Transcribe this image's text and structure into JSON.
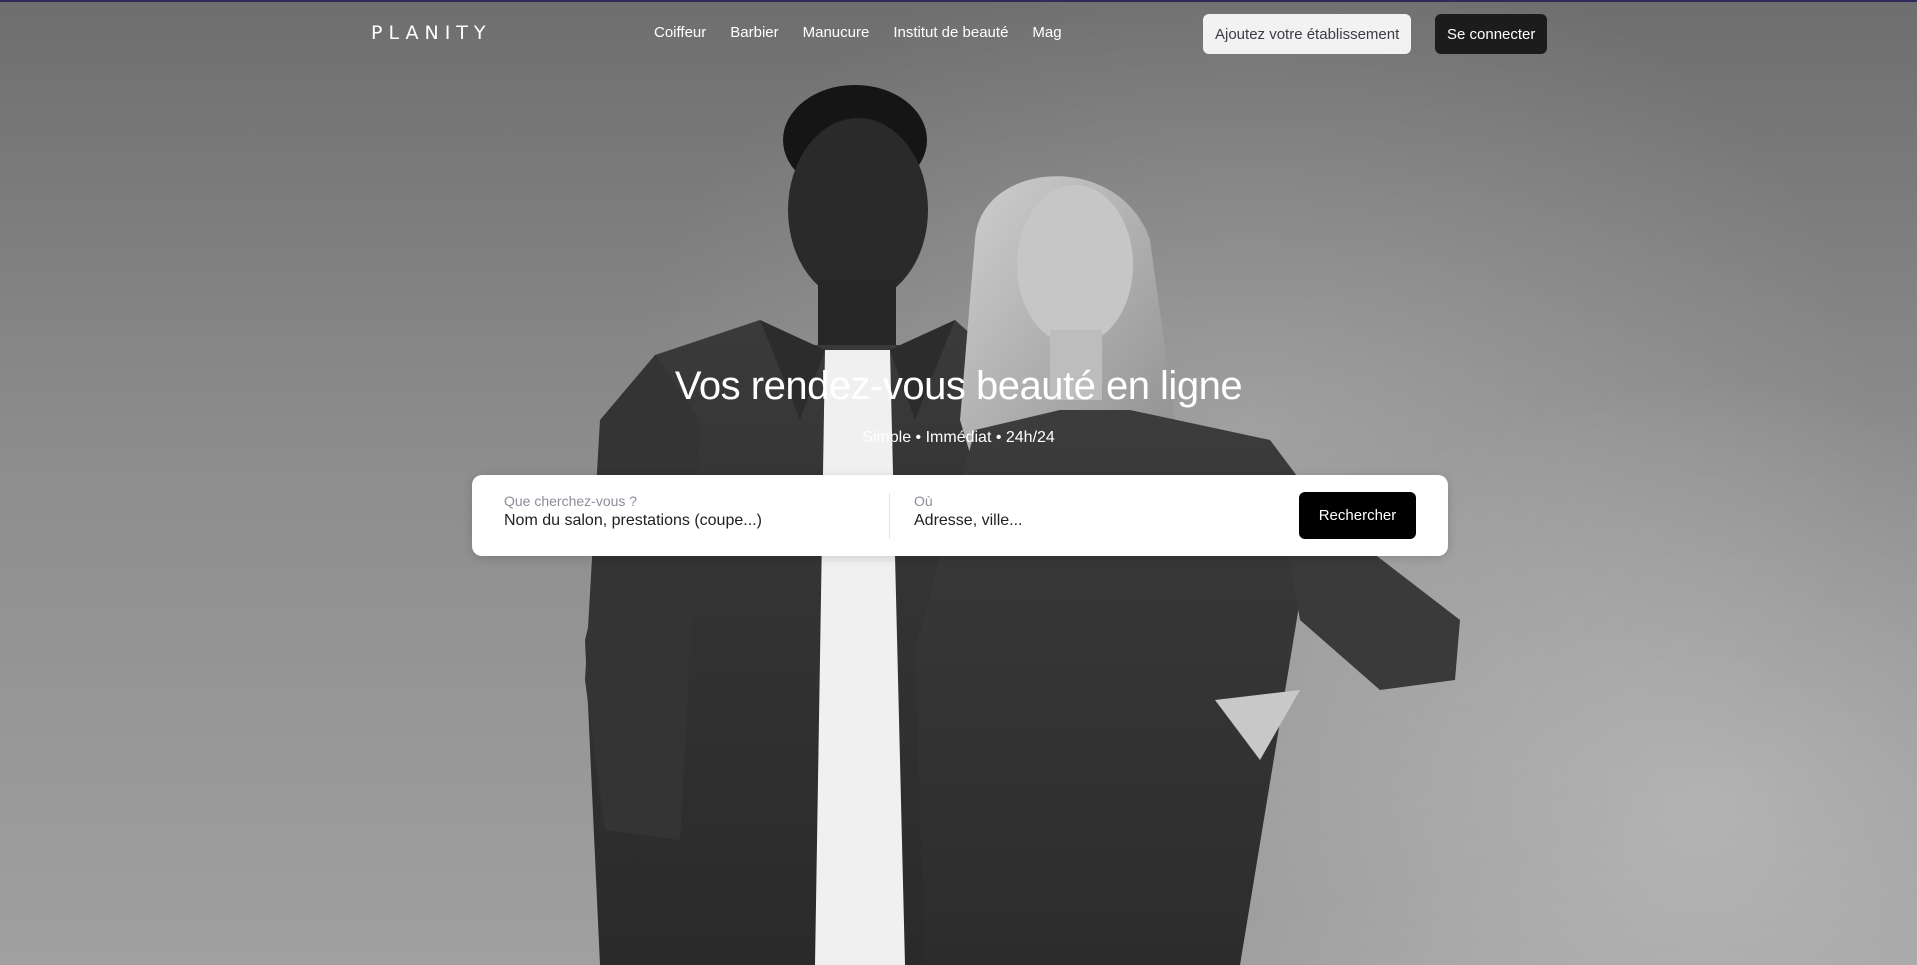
{
  "header": {
    "logo": "PLANITY",
    "nav": [
      "Coiffeur",
      "Barbier",
      "Manucure",
      "Institut de beauté",
      "Mag"
    ],
    "add_business_label": "Ajoutez votre établissement",
    "login_label": "Se connecter"
  },
  "hero": {
    "title": "Vos rendez-vous beauté en ligne",
    "subtitle": "Simple • Immédiat • 24h/24"
  },
  "search": {
    "what_label": "Que cherchez-vous ?",
    "what_placeholder": "Nom du salon, prestations (coupe...)",
    "where_label": "Où",
    "where_placeholder": "Adresse, ville...",
    "submit_label": "Rechercher"
  },
  "colors": {
    "background_top": "#6e6e6e",
    "background_bottom": "#a0a0a0",
    "accent_line": "#2e2a5a",
    "primary_button": "#000000",
    "secondary_button": "#f2f2f2"
  }
}
